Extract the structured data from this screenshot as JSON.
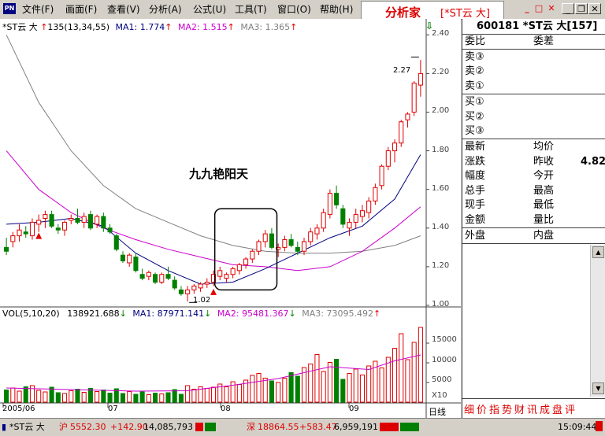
{
  "menubar": {
    "app_icon": "PN",
    "items": [
      "文件(F)",
      "画面(F)",
      "查看(V)",
      "分析(A)",
      "公式(U)",
      "工具(T)",
      "窗口(O)",
      "帮助(H)"
    ],
    "brand": "分析家",
    "brand_stock": "[*ST云 大]"
  },
  "price_legend": {
    "name": "*ST云 大",
    "params": "135(13,34,55)",
    "ma1": "MA1: 1.774",
    "ma2": "MA2: 1.515",
    "ma3": "MA3: 1.365"
  },
  "annotations": {
    "pattern": "九九艳阳天",
    "high": "2.27",
    "low": "1.02"
  },
  "price_axis": [
    "2.40",
    "2.20",
    "2.00",
    "1.80",
    "1.60",
    "1.40",
    "1.20",
    "1.00"
  ],
  "vol_legend": {
    "label": "VOL(5,10,20)",
    "vol": "138921.688",
    "ma1": "MA1: 87971.141",
    "ma2": "MA2: 95481.367",
    "ma3": "MA3: 73095.492"
  },
  "vol_axis": [
    "15000",
    "10000",
    "5000",
    "X10"
  ],
  "date_axis": [
    "2005/06",
    "07",
    "08",
    "09"
  ],
  "period_label": "日线",
  "right_panel": {
    "header": "600181 *ST云 大[157]",
    "weibi": "委比",
    "weicha": "委差",
    "sell": [
      "卖③",
      "卖②",
      "卖①"
    ],
    "buy": [
      "买①",
      "买②",
      "买③"
    ],
    "quote": [
      [
        "最新",
        "均价",
        ""
      ],
      [
        "涨跌",
        "昨收",
        "4.82"
      ],
      [
        "幅度",
        "今开",
        ""
      ],
      [
        "总手",
        "最高",
        ""
      ],
      [
        "现手",
        "最低",
        ""
      ],
      [
        "金额",
        "量比",
        ""
      ]
    ],
    "waipan": "外盘",
    "neipan": "内盘",
    "tabs": "细价指势财讯成盘评"
  },
  "status": {
    "sh_label": "沪",
    "sh_value": "5552.30",
    "sh_change": "+142.90",
    "sh_volume": "14,085,793",
    "sz_label": "深",
    "sz_value": "18864.55",
    "sz_change": "+583.47",
    "sz_volume": "6,959,191",
    "time": "15:09:44",
    "stock": "*ST云 大"
  },
  "chart_data": {
    "type": "candlestick",
    "y_range": [
      1.0,
      2.45
    ],
    "vol_range": [
      0,
      19000
    ],
    "pattern_box": {
      "from_index": 33,
      "to_index": 41,
      "price_low": 1.08,
      "price_high": 1.5
    },
    "candles": [
      [
        1.3,
        1.35,
        1.26,
        1.28
      ],
      [
        1.33,
        1.38,
        1.3,
        1.36
      ],
      [
        1.36,
        1.42,
        1.33,
        1.39
      ],
      [
        1.38,
        1.41,
        1.35,
        1.37
      ],
      [
        1.36,
        1.45,
        1.34,
        1.43
      ],
      [
        1.42,
        1.47,
        1.38,
        1.44
      ],
      [
        1.45,
        1.49,
        1.4,
        1.47
      ],
      [
        1.47,
        1.49,
        1.4,
        1.41
      ],
      [
        1.4,
        1.42,
        1.37,
        1.39
      ],
      [
        1.39,
        1.44,
        1.36,
        1.43
      ],
      [
        1.44,
        1.47,
        1.42,
        1.45
      ],
      [
        1.45,
        1.5,
        1.42,
        1.43
      ],
      [
        1.43,
        1.48,
        1.4,
        1.46
      ],
      [
        1.47,
        1.49,
        1.39,
        1.4
      ],
      [
        1.42,
        1.47,
        1.4,
        1.46
      ],
      [
        1.46,
        1.48,
        1.38,
        1.4
      ],
      [
        1.4,
        1.42,
        1.37,
        1.38
      ],
      [
        1.36,
        1.37,
        1.28,
        1.29
      ],
      [
        1.26,
        1.28,
        1.22,
        1.23
      ],
      [
        1.22,
        1.27,
        1.2,
        1.26
      ],
      [
        1.25,
        1.27,
        1.17,
        1.18
      ],
      [
        1.16,
        1.19,
        1.13,
        1.14
      ],
      [
        1.15,
        1.18,
        1.13,
        1.17
      ],
      [
        1.16,
        1.17,
        1.11,
        1.12
      ],
      [
        1.12,
        1.17,
        1.11,
        1.16
      ],
      [
        1.16,
        1.2,
        1.13,
        1.14
      ],
      [
        1.13,
        1.15,
        1.08,
        1.09
      ],
      [
        1.08,
        1.1,
        1.05,
        1.06
      ],
      [
        1.06,
        1.1,
        1.02,
        1.08
      ],
      [
        1.08,
        1.11,
        1.06,
        1.1
      ],
      [
        1.09,
        1.12,
        1.07,
        1.11
      ],
      [
        1.11,
        1.14,
        1.09,
        1.12
      ],
      [
        1.12,
        1.18,
        1.1,
        1.16
      ],
      [
        1.15,
        1.2,
        1.13,
        1.18
      ],
      [
        1.14,
        1.17,
        1.12,
        1.16
      ],
      [
        1.16,
        1.2,
        1.14,
        1.19
      ],
      [
        1.18,
        1.22,
        1.16,
        1.21
      ],
      [
        1.21,
        1.25,
        1.19,
        1.24
      ],
      [
        1.24,
        1.29,
        1.22,
        1.28
      ],
      [
        1.28,
        1.34,
        1.26,
        1.33
      ],
      [
        1.33,
        1.39,
        1.3,
        1.37
      ],
      [
        1.37,
        1.4,
        1.29,
        1.3
      ],
      [
        1.29,
        1.32,
        1.25,
        1.3
      ],
      [
        1.3,
        1.36,
        1.28,
        1.34
      ],
      [
        1.34,
        1.37,
        1.3,
        1.31
      ],
      [
        1.3,
        1.33,
        1.26,
        1.28
      ],
      [
        1.28,
        1.35,
        1.26,
        1.33
      ],
      [
        1.33,
        1.4,
        1.31,
        1.38
      ],
      [
        1.37,
        1.42,
        1.34,
        1.4
      ],
      [
        1.4,
        1.5,
        1.38,
        1.48
      ],
      [
        1.47,
        1.6,
        1.45,
        1.58
      ],
      [
        1.58,
        1.62,
        1.5,
        1.52
      ],
      [
        1.5,
        1.52,
        1.4,
        1.42
      ],
      [
        1.4,
        1.45,
        1.36,
        1.43
      ],
      [
        1.43,
        1.5,
        1.4,
        1.47
      ],
      [
        1.46,
        1.52,
        1.43,
        1.49
      ],
      [
        1.48,
        1.56,
        1.45,
        1.54
      ],
      [
        1.54,
        1.63,
        1.52,
        1.61
      ],
      [
        1.62,
        1.73,
        1.6,
        1.72
      ],
      [
        1.72,
        1.82,
        1.7,
        1.8
      ],
      [
        1.8,
        1.86,
        1.74,
        1.84
      ],
      [
        1.84,
        1.96,
        1.82,
        1.95
      ],
      [
        1.96,
        2.0,
        1.92,
        1.99
      ],
      [
        2.0,
        2.16,
        1.98,
        2.15
      ],
      [
        2.14,
        2.27,
        2.08,
        2.2
      ]
    ],
    "ma1": [
      [
        0,
        1.42
      ],
      [
        5,
        1.43
      ],
      [
        10,
        1.45
      ],
      [
        15,
        1.41
      ],
      [
        20,
        1.27
      ],
      [
        25,
        1.18
      ],
      [
        30,
        1.11
      ],
      [
        35,
        1.12
      ],
      [
        40,
        1.19
      ],
      [
        45,
        1.27
      ],
      [
        50,
        1.35
      ],
      [
        55,
        1.41
      ],
      [
        60,
        1.55
      ],
      [
        64,
        1.78
      ]
    ],
    "ma2": [
      [
        0,
        1.8
      ],
      [
        5,
        1.6
      ],
      [
        10,
        1.48
      ],
      [
        15,
        1.4
      ],
      [
        20,
        1.34
      ],
      [
        25,
        1.29
      ],
      [
        30,
        1.25
      ],
      [
        35,
        1.21
      ],
      [
        40,
        1.2
      ],
      [
        45,
        1.18
      ],
      [
        50,
        1.2
      ],
      [
        55,
        1.28
      ],
      [
        60,
        1.4
      ],
      [
        64,
        1.51
      ]
    ],
    "ma3": [
      [
        0,
        2.4
      ],
      [
        5,
        2.05
      ],
      [
        10,
        1.8
      ],
      [
        15,
        1.62
      ],
      [
        20,
        1.5
      ],
      [
        25,
        1.43
      ],
      [
        30,
        1.36
      ],
      [
        35,
        1.31
      ],
      [
        40,
        1.28
      ],
      [
        45,
        1.27
      ],
      [
        50,
        1.27
      ],
      [
        55,
        1.28
      ],
      [
        60,
        1.31
      ],
      [
        64,
        1.36
      ]
    ],
    "volumes": [
      3100,
      3600,
      2800,
      3900,
      4200,
      3000,
      2600,
      3800,
      2400,
      2200,
      2900,
      3300,
      2500,
      3500,
      2700,
      3100,
      2300,
      3400,
      2200,
      2700,
      2000,
      2600,
      1900,
      2300,
      2100,
      2400,
      3200,
      2000,
      4200,
      3300,
      3900,
      3500,
      3800,
      4600,
      3900,
      5200,
      4500,
      5600,
      6800,
      7300,
      6100,
      5400,
      5000,
      6100,
      7500,
      6600,
      8800,
      9700,
      12100,
      7800,
      10100,
      10900,
      5800,
      7300,
      8400,
      6900,
      9200,
      10400,
      8700,
      11400,
      13700,
      17400,
      10800,
      15200,
      19000
    ],
    "vol_ma": [
      [
        0,
        3600
      ],
      [
        10,
        3200
      ],
      [
        20,
        2800
      ],
      [
        28,
        2900
      ],
      [
        35,
        4300
      ],
      [
        42,
        6000
      ],
      [
        50,
        9000
      ],
      [
        56,
        8300
      ],
      [
        60,
        10500
      ],
      [
        64,
        12000
      ]
    ]
  }
}
